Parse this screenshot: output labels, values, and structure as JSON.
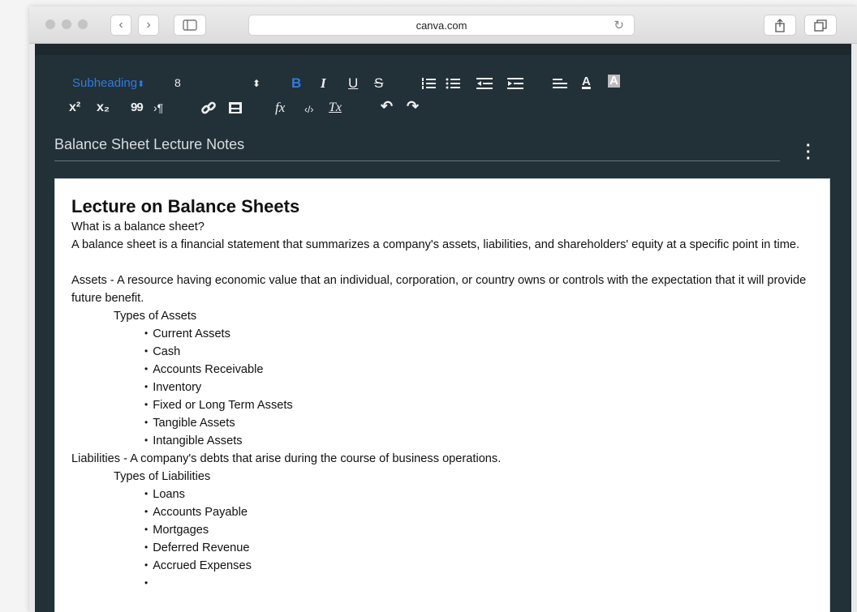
{
  "browser": {
    "url": "canva.com",
    "reload_icon": "↻",
    "back_icon": "‹",
    "forward_icon": "›",
    "sidebar_icon": "sidebar-icon",
    "share_icon": "share-icon",
    "tabs_icon": "tabs-icon"
  },
  "toolbar": {
    "style_select": "Subheading",
    "size_select": "8",
    "bold": "B",
    "italic": "I",
    "underline": "U",
    "strike": "S",
    "superscript": "x²",
    "subscript": "x₂",
    "quote": "99",
    "paragraph": "›¶",
    "function": "fx",
    "code": "‹/›",
    "clear_format": "Tx",
    "undo": "↶",
    "redo": "↷"
  },
  "document": {
    "title": "Balance Sheet Lecture Notes",
    "heading": "Lecture on Balance Sheets",
    "lines": [
      {
        "text": "What is a balance sheet?",
        "indent": 0,
        "bullet": false
      },
      {
        "text": "A balance sheet is a financial statement that summarizes a company's assets, liabilities, and shareholders' equity at a specific point in time.",
        "indent": 0,
        "bullet": false
      },
      {
        "text": "",
        "indent": 0,
        "bullet": false
      },
      {
        "text": "Assets - A resource having economic value that an individual, corporation, or country owns or controls with the expectation that it will provide future benefit.",
        "indent": 0,
        "bullet": false
      },
      {
        "text": "Types of Assets",
        "indent": 1,
        "bullet": false
      },
      {
        "text": "Current Assets",
        "indent": 2,
        "bullet": true
      },
      {
        "text": "Cash",
        "indent": 2,
        "bullet": true
      },
      {
        "text": "Accounts Receivable",
        "indent": 2,
        "bullet": true
      },
      {
        "text": "Inventory",
        "indent": 2,
        "bullet": true
      },
      {
        "text": "Fixed or Long Term Assets",
        "indent": 2,
        "bullet": true
      },
      {
        "text": "Tangible Assets",
        "indent": 2,
        "bullet": true
      },
      {
        "text": "Intangible Assets",
        "indent": 2,
        "bullet": true
      },
      {
        "text": "Liabilities - A company's debts that arise during the course of business operations.",
        "indent": 0,
        "bullet": false
      },
      {
        "text": "Types of Liabilities",
        "indent": 1,
        "bullet": false
      },
      {
        "text": "Loans",
        "indent": 2,
        "bullet": true
      },
      {
        "text": "Accounts Payable",
        "indent": 2,
        "bullet": true
      },
      {
        "text": "Mortgages",
        "indent": 2,
        "bullet": true
      },
      {
        "text": "Deferred Revenue",
        "indent": 2,
        "bullet": true
      },
      {
        "text": "Accrued Expenses",
        "indent": 2,
        "bullet": true
      },
      {
        "text": "",
        "indent": 2,
        "bullet": true
      }
    ]
  },
  "colors": {
    "editor_bg": "#223038",
    "accent_blue": "#2f7bdf",
    "page_bg": "#ffffff"
  }
}
